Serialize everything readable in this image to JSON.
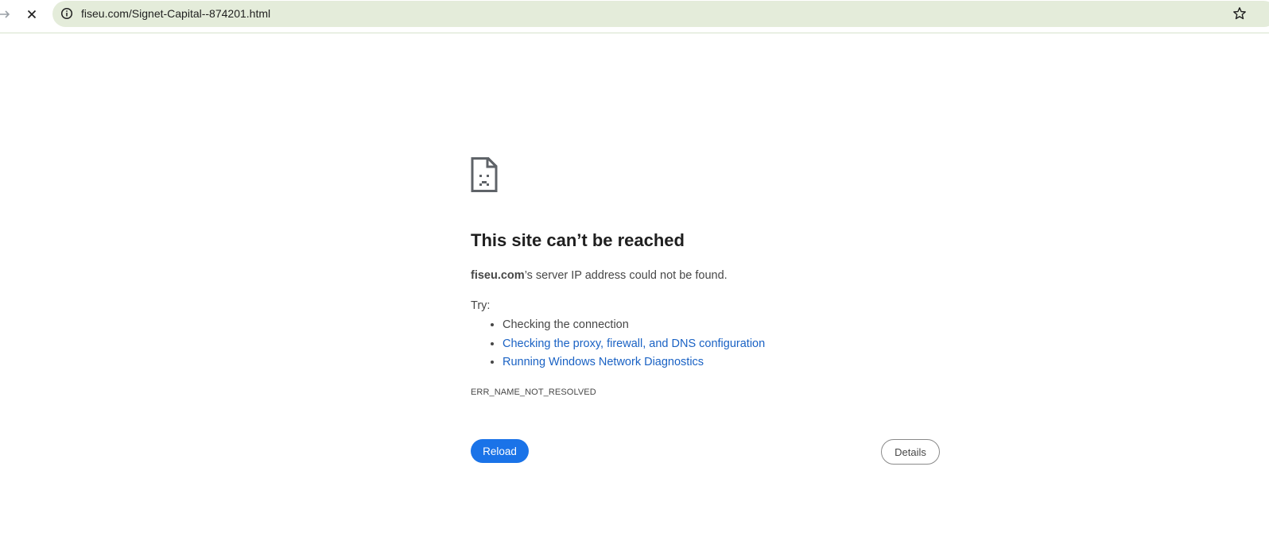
{
  "browser": {
    "url": "fiseu.com/Signet-Capital--874201.html",
    "forward_icon": "arrow-right-icon",
    "stop_icon": "close-icon",
    "site_info_icon": "info-circle-icon",
    "bookmark_icon": "star-outline-icon"
  },
  "error_page": {
    "icon": "sad-document-icon",
    "title": "This site can’t be reached",
    "host": "fiseu.com",
    "message_rest": "’s server IP address could not be found.",
    "try_label": "Try:",
    "suggestions": [
      {
        "text": "Checking the connection",
        "link": false
      },
      {
        "text": "Checking the proxy, firewall, and DNS configuration",
        "link": true
      },
      {
        "text": "Running Windows Network Diagnostics",
        "link": true
      }
    ],
    "error_code": "ERR_NAME_NOT_RESOLVED",
    "reload_label": "Reload",
    "details_label": "Details"
  },
  "colors": {
    "accent": "#1a73e8",
    "link": "#1a62c4",
    "omnibox_bg": "#e4ecda"
  }
}
